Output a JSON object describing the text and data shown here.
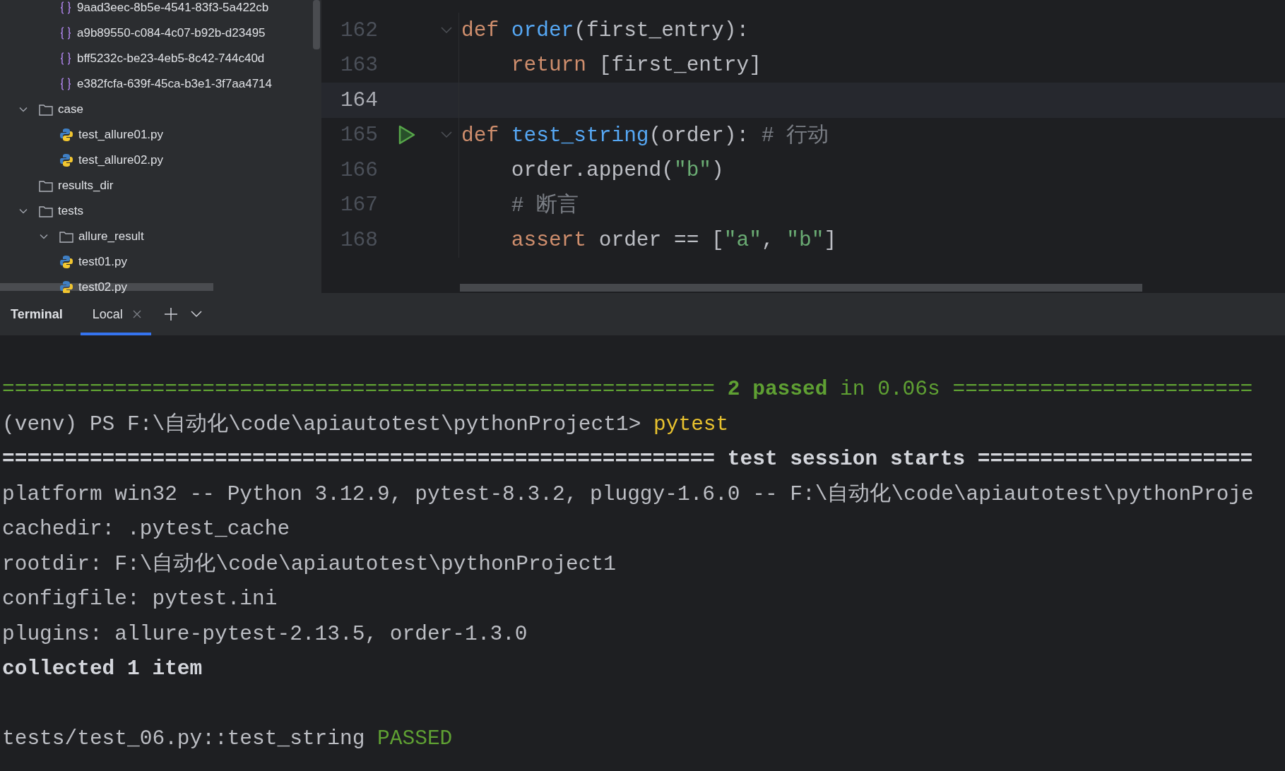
{
  "project_tree": {
    "children": [
      {
        "children": [
          {
            "label": "9aad3eec-8b5e-4541-83f3-5a422cb",
            "kind": "json"
          },
          {
            "label": "a9b89550-c084-4c07-b92b-d23495",
            "kind": "json"
          },
          {
            "label": "bff5232c-be23-4eb5-8c42-744c40d",
            "kind": "json"
          },
          {
            "label": "e382fcfa-639f-45ca-b3e1-3f7aa4714",
            "kind": "json"
          }
        ]
      },
      {
        "label": "case",
        "kind": "folder",
        "expanded": true,
        "children": [
          {
            "label": "test_allure01.py",
            "kind": "python"
          },
          {
            "label": "test_allure02.py",
            "kind": "python"
          }
        ]
      },
      {
        "label": "results_dir",
        "kind": "folder"
      },
      {
        "label": "tests",
        "kind": "folder",
        "expanded": true,
        "children": [
          {
            "label": "allure_result",
            "kind": "folder",
            "expanded": true
          },
          {
            "label": "test01.py",
            "kind": "python"
          },
          {
            "label": "test02.py",
            "kind": "python"
          }
        ]
      }
    ]
  },
  "editor": {
    "lines": [
      {
        "number": "162",
        "current": false,
        "run_button": false,
        "foldable": true,
        "tokens": [
          {
            "text": "def ",
            "kind": "keyword"
          },
          {
            "text": "order",
            "kind": "function"
          },
          {
            "text": "(first_entry):",
            "kind": "plain"
          }
        ]
      },
      {
        "number": "163",
        "current": false,
        "run_button": false,
        "foldable": false,
        "tokens": [
          {
            "text": "    return ",
            "kind": "keyword"
          },
          {
            "text": "[first_entry]",
            "kind": "plain"
          }
        ]
      },
      {
        "number": "164",
        "current": true,
        "run_button": false,
        "foldable": false
      },
      {
        "number": "165",
        "current": false,
        "run_button": true,
        "foldable": true,
        "tokens": [
          {
            "text": "def ",
            "kind": "keyword"
          },
          {
            "text": "test_string",
            "kind": "function"
          },
          {
            "text": "(order): ",
            "kind": "plain"
          },
          {
            "text": "# 行动",
            "kind": "comment"
          }
        ]
      },
      {
        "number": "166",
        "current": false,
        "run_button": false,
        "foldable": false,
        "tokens": [
          {
            "text": "    order.append(",
            "kind": "plain"
          },
          {
            "text": "\"b\"",
            "kind": "string"
          },
          {
            "text": ")",
            "kind": "plain"
          }
        ]
      },
      {
        "number": "167",
        "current": false,
        "run_button": false,
        "foldable": false,
        "tokens": [
          {
            "text": "    # 断言",
            "kind": "comment"
          }
        ]
      },
      {
        "number": "168",
        "current": false,
        "run_button": false,
        "foldable": false,
        "tokens": [
          {
            "text": "    assert ",
            "kind": "keyword"
          },
          {
            "text": "order == [",
            "kind": "plain"
          },
          {
            "text": "\"a\"",
            "kind": "string"
          },
          {
            "text": ", ",
            "kind": "plain"
          },
          {
            "text": "\"b\"",
            "kind": "string"
          },
          {
            "text": "]",
            "kind": "plain"
          }
        ]
      }
    ]
  },
  "terminal": {
    "title": "Terminal",
    "tabs": [
      {
        "label": "Local",
        "selected": true
      }
    ],
    "lines": [
      {
        "kind": "text",
        "segments": [
          {
            "text": "========================================================= ",
            "kind": "summary"
          },
          {
            "text": "2 passed",
            "kind": "summary_count"
          },
          {
            "text": " in 0.06s ========================",
            "kind": "summary"
          }
        ]
      },
      {
        "kind": "text",
        "segments": [
          {
            "text": "(venv) PS F:\\自动化\\code\\apiautotest\\pythonProject1> ",
            "kind": "prompt"
          },
          {
            "text": "pytest",
            "kind": "command"
          }
        ]
      },
      {
        "kind": "text",
        "segments": [
          {
            "text": "========================================================= test session starts ======================",
            "kind": "heading"
          }
        ]
      },
      {
        "kind": "text",
        "segments": [
          {
            "text": "platform win32 -- Python 3.12.9, pytest-8.3.2, pluggy-1.6.0 -- F:\\自动化\\code\\apiautotest\\pythonProje",
            "kind": "output"
          }
        ]
      },
      {
        "kind": "text",
        "segments": [
          {
            "text": "cachedir: .pytest_cache",
            "kind": "output"
          }
        ]
      },
      {
        "kind": "text",
        "segments": [
          {
            "text": "rootdir: F:\\自动化\\code\\apiautotest\\pythonProject1",
            "kind": "output"
          }
        ]
      },
      {
        "kind": "text",
        "segments": [
          {
            "text": "configfile: pytest.ini",
            "kind": "output"
          }
        ]
      },
      {
        "kind": "text",
        "segments": [
          {
            "text": "plugins: allure-pytest-2.13.5, order-1.3.0",
            "kind": "output"
          }
        ]
      },
      {
        "kind": "text",
        "segments": [
          {
            "text": "collected 1 item",
            "kind": "heading"
          }
        ]
      },
      {
        "kind": "blank"
      },
      {
        "kind": "text",
        "segments": [
          {
            "text": "tests/test_06.py::test_string ",
            "kind": "output"
          },
          {
            "text": "PASSED",
            "kind": "summary"
          }
        ]
      }
    ]
  }
}
